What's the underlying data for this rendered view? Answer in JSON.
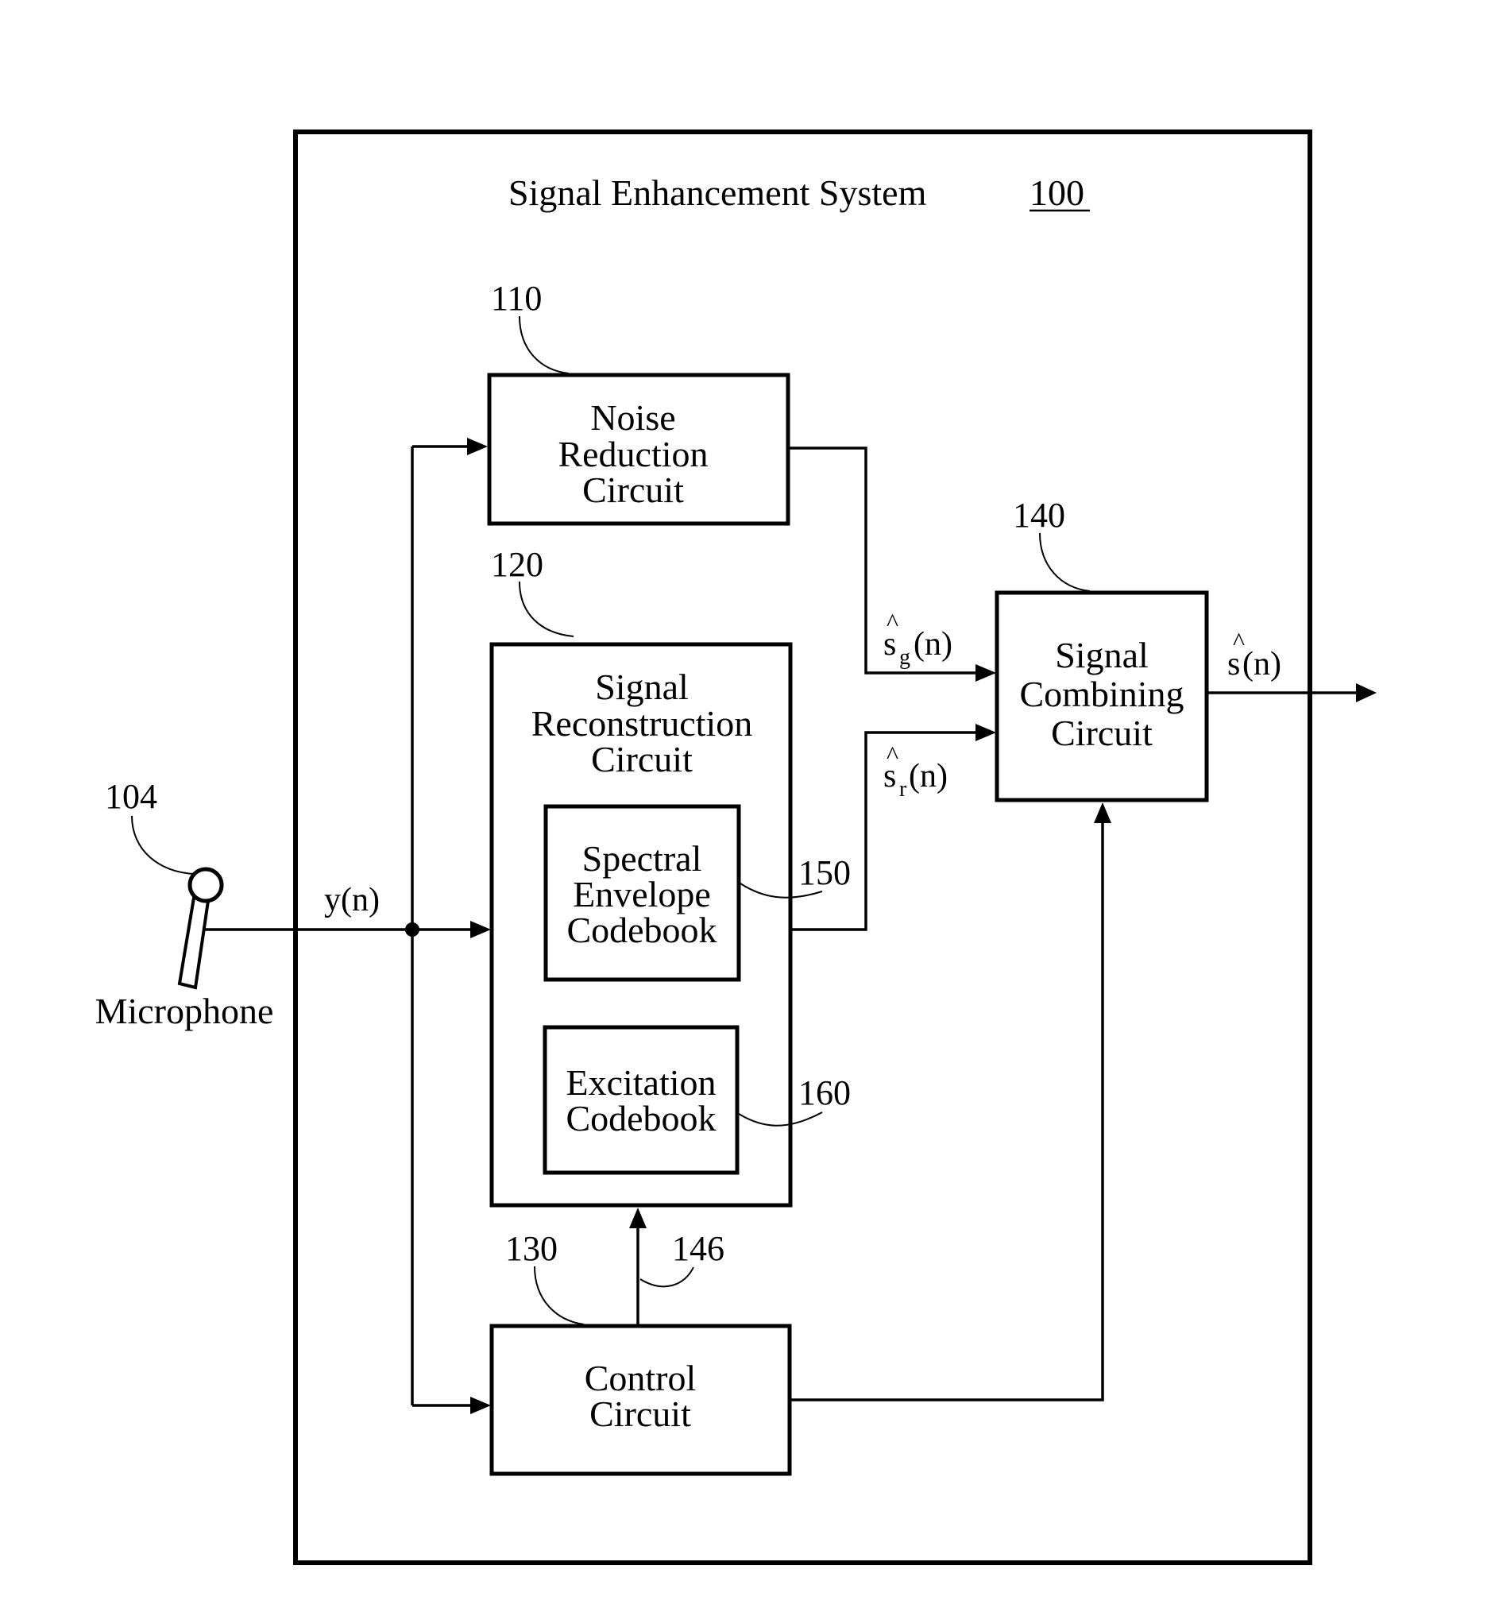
{
  "title": {
    "text": "Signal Enhancement System",
    "ref": "100"
  },
  "microphone": {
    "label": "Microphone",
    "ref": "104"
  },
  "blocks": {
    "noise_reduction": {
      "lines": [
        "Noise",
        "Reduction",
        "Circuit"
      ],
      "ref": "110"
    },
    "signal_reconstruction": {
      "lines": [
        "Signal",
        "Reconstruction",
        "Circuit"
      ],
      "ref": "120"
    },
    "spectral_envelope_codebook": {
      "lines": [
        "Spectral",
        "Envelope",
        "Codebook"
      ],
      "ref": "150"
    },
    "excitation_codebook": {
      "lines": [
        "Excitation",
        "Codebook"
      ],
      "ref": "160"
    },
    "control": {
      "lines": [
        "Control",
        "Circuit"
      ],
      "ref": "130"
    },
    "signal_combining": {
      "lines": [
        "Signal",
        "Combining",
        "Circuit"
      ],
      "ref": "140"
    }
  },
  "signals": {
    "input": "y(n)",
    "noise_out": {
      "base": "s",
      "sub": "g",
      "arg": "(n)",
      "hat": "^"
    },
    "recon_out": {
      "base": "s",
      "sub": "r",
      "arg": "(n)",
      "hat": "^"
    },
    "output": {
      "base": "s",
      "arg": "(n)",
      "hat": "^"
    },
    "control_link_ref": "146"
  }
}
